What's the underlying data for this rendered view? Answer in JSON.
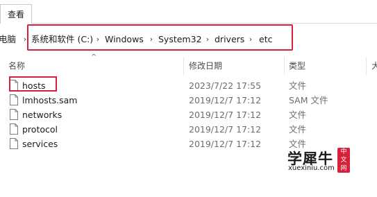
{
  "ribbon": {
    "tab_label": "查看"
  },
  "address": {
    "root_partial": "电脑",
    "crumbs": [
      "系统和软件 (C:)",
      "Windows",
      "System32",
      "drivers",
      "etc"
    ],
    "separator": "›"
  },
  "columns": {
    "name": "名称",
    "date": "修改日期",
    "type": "类型",
    "size_partial": "大"
  },
  "files": [
    {
      "name": "hosts",
      "date": "2023/7/22 17:55",
      "type": "文件"
    },
    {
      "name": "lmhosts.sam",
      "date": "2019/12/7 17:12",
      "type": "SAM 文件"
    },
    {
      "name": "networks",
      "date": "2019/12/7 17:12",
      "type": "文件"
    },
    {
      "name": "protocol",
      "date": "2019/12/7 17:12",
      "type": "文件"
    },
    {
      "name": "services",
      "date": "2019/12/7 17:12",
      "type": "文件"
    }
  ],
  "watermark": {
    "main": "学犀牛",
    "sub": "xuexiniu.com",
    "seal": "中文网"
  },
  "colors": {
    "highlight": "#d8203b",
    "secondary_text": "#6d6d6d"
  },
  "icons": {
    "file": "document-icon",
    "sort": "sort-ascending-icon",
    "chevron": "chevron-right-icon"
  }
}
